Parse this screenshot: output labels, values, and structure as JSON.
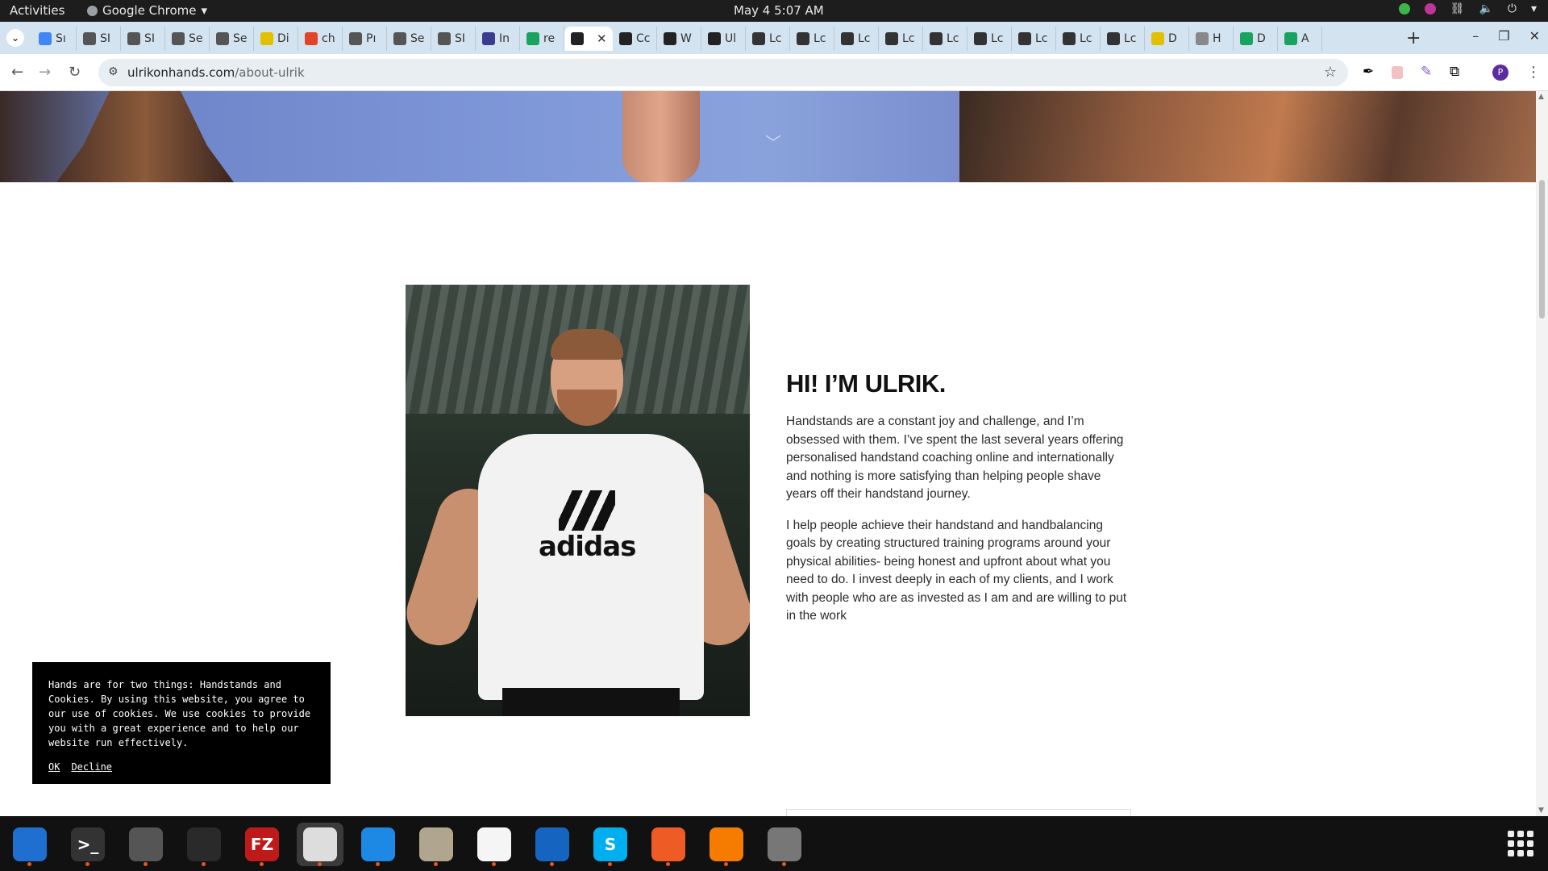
{
  "system": {
    "activities": "Activities",
    "app_name": "Google Chrome",
    "clock": "May 4  5:07 AM"
  },
  "tabs": [
    {
      "label": "Sı",
      "color": "#4285f4"
    },
    {
      "label": "SI",
      "color": "#555555"
    },
    {
      "label": "SI",
      "color": "#555555"
    },
    {
      "label": "Se",
      "color": "#555555"
    },
    {
      "label": "Se",
      "color": "#555555"
    },
    {
      "label": "Di",
      "color": "#e0c000"
    },
    {
      "label": "ch",
      "color": "#e24329"
    },
    {
      "label": "Pı",
      "color": "#555555"
    },
    {
      "label": "Se",
      "color": "#555555"
    },
    {
      "label": "SI",
      "color": "#555555"
    },
    {
      "label": "In",
      "color": "#3b3b8f"
    },
    {
      "label": "re",
      "color": "#1aa260"
    },
    {
      "label": "",
      "color": "#222222",
      "active": true
    },
    {
      "label": "Cc",
      "color": "#222222"
    },
    {
      "label": "W",
      "color": "#222222"
    },
    {
      "label": "Ul",
      "color": "#222222"
    },
    {
      "label": "Lc",
      "color": "#333333"
    },
    {
      "label": "Lc",
      "color": "#333333"
    },
    {
      "label": "Lc",
      "color": "#333333"
    },
    {
      "label": "Lc",
      "color": "#333333"
    },
    {
      "label": "Lc",
      "color": "#333333"
    },
    {
      "label": "Lc",
      "color": "#333333"
    },
    {
      "label": "Lc",
      "color": "#333333"
    },
    {
      "label": "Lc",
      "color": "#333333"
    },
    {
      "label": "Lc",
      "color": "#333333"
    },
    {
      "label": "D",
      "color": "#e0c000"
    },
    {
      "label": "H",
      "color": "#888888"
    },
    {
      "label": "D",
      "color": "#1aa260"
    },
    {
      "label": "A",
      "color": "#1aa260"
    }
  ],
  "toolbar": {
    "url_domain": "ulrikonhands.com",
    "url_path": "/about-ulrik",
    "profile_initial": "P"
  },
  "about": {
    "heading": "HI! I’M ULRIK.",
    "paragraph1": "Handstands are a constant joy and challenge, and I’m obsessed with them. I’ve spent the last several years offering personalised handstand coaching online and internationally and nothing is more satisfying than helping people shave years off their handstand journey.",
    "paragraph2": "I help people achieve their handstand and handbalancing goals by creating structured training programs around your physical abilities- being honest and upfront about what you need to do. I invest deeply in each of my clients, and I work with people who are as invested as I am and are willing to put in the work",
    "photo_shirt_brand": "adidas"
  },
  "cookie": {
    "message": "Hands are for two things: Handstands and Cookies. By using this website, you agree to our use of cookies. We use cookies to provide you with a great experience and to help our website run effectively.",
    "ok_label": "OK",
    "decline_label": "Decline"
  },
  "dock": [
    {
      "name": "thunderbird",
      "color": "#1f6fd1",
      "glyph": ""
    },
    {
      "name": "terminal",
      "color": "#333333",
      "glyph": ">_"
    },
    {
      "name": "calculator",
      "color": "#555555",
      "glyph": ""
    },
    {
      "name": "system-monitor",
      "color": "#2a2a2a",
      "glyph": ""
    },
    {
      "name": "filezilla",
      "color": "#bf1a1a",
      "glyph": "FZ"
    },
    {
      "name": "chrome",
      "color": "#dddddd",
      "glyph": "",
      "active": true
    },
    {
      "name": "vscode",
      "color": "#1e88e5",
      "glyph": ""
    },
    {
      "name": "files",
      "color": "#b0a58f",
      "glyph": ""
    },
    {
      "name": "text-editor",
      "color": "#f5f5f5",
      "glyph": ""
    },
    {
      "name": "libreoffice-writer",
      "color": "#1565c0",
      "glyph": ""
    },
    {
      "name": "skype",
      "color": "#00aff0",
      "glyph": "S"
    },
    {
      "name": "postman",
      "color": "#ef5b25",
      "glyph": ""
    },
    {
      "name": "firefox-like",
      "color": "#f57c00",
      "glyph": ""
    },
    {
      "name": "disk-utility",
      "color": "#777777",
      "glyph": ""
    }
  ]
}
